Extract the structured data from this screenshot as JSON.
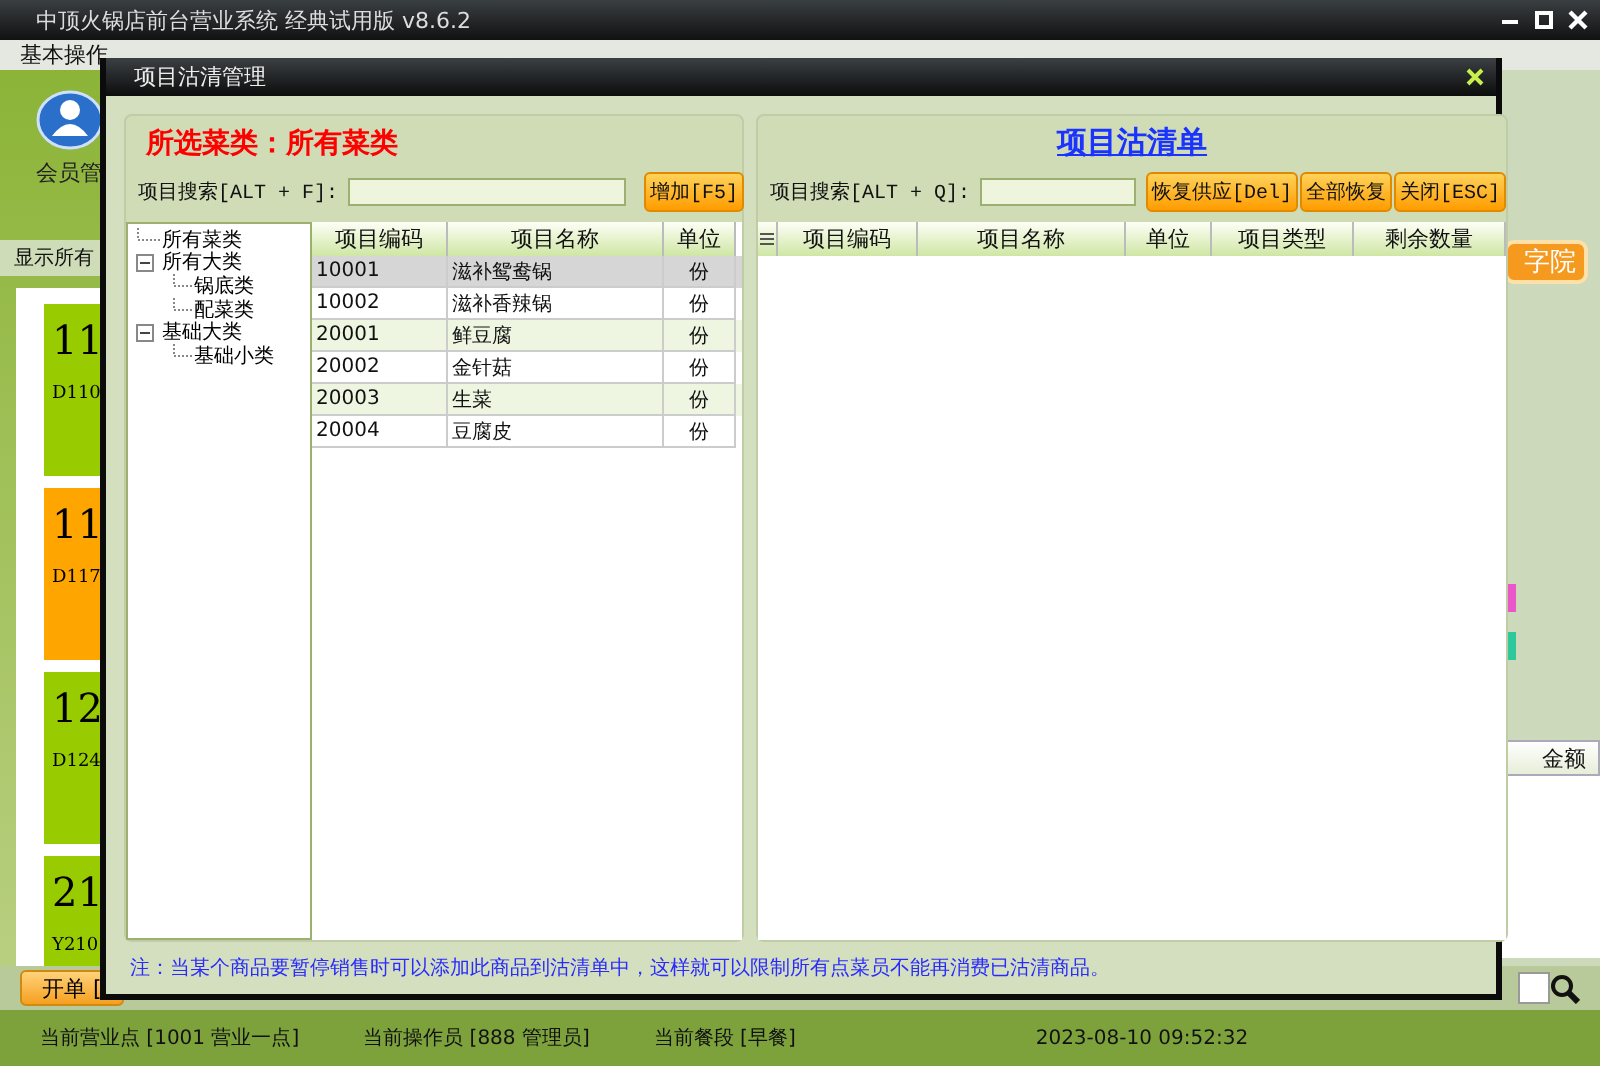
{
  "app": {
    "title": "中顶火锅店前台营业系统 经典试用版 v8.6.2",
    "menu": [
      "基本操作"
    ],
    "member_label": "会员管",
    "show_all": "显示所有",
    "tables": [
      {
        "number": "11",
        "code": "D110",
        "color": "#99cc00"
      },
      {
        "number": "11",
        "code": "D117",
        "color": "#ffa500"
      },
      {
        "number": "12",
        "code": "D124",
        "color": "#99cc00"
      },
      {
        "number": "21",
        "code": "Y210",
        "color": "#99cc00"
      }
    ],
    "academy_button": "字院",
    "swatches": [
      {
        "color": "#e957c8"
      },
      {
        "color": "#2ec99a"
      }
    ],
    "order_column": "金额",
    "open_button": "开单 ["
  },
  "dialog": {
    "title": "项目沽清管理",
    "left": {
      "heading": "所选菜类：所有菜类",
      "search_label": "项目搜索[ALT + F]:",
      "add_button": "增加[F5]",
      "tree": [
        {
          "label": "所有菜类"
        },
        {
          "label": "所有大类",
          "expanded": true,
          "children": [
            {
              "label": "锅底类"
            },
            {
              "label": "配菜类"
            }
          ]
        },
        {
          "label": "基础大类",
          "expanded": true,
          "children": [
            {
              "label": "基础小类"
            }
          ]
        }
      ],
      "columns": [
        "项目编码",
        "项目名称",
        "单位"
      ],
      "rows": [
        {
          "cells": [
            "10001",
            "滋补鸳鸯锅",
            "份"
          ],
          "selected": true
        },
        {
          "cells": [
            "10002",
            "滋补香辣锅",
            "份"
          ],
          "selected": false
        },
        {
          "cells": [
            "20001",
            "鲜豆腐",
            "份"
          ],
          "selected": false
        },
        {
          "cells": [
            "20002",
            "金针菇",
            "份"
          ],
          "selected": false
        },
        {
          "cells": [
            "20003",
            "生菜",
            "份"
          ],
          "selected": false
        },
        {
          "cells": [
            "20004",
            "豆腐皮",
            "份"
          ],
          "selected": false
        }
      ]
    },
    "right": {
      "title": "项目沽清单",
      "search_label": "项目搜索[ALT + Q]:",
      "buttons": [
        "恢复供应[Del]",
        "全部恢复",
        "关闭[ESC]"
      ],
      "columns": [
        "项目编码",
        "项目名称",
        "单位",
        "项目类型",
        "剩余数量"
      ]
    },
    "note": "注：当某个商品要暂停销售时可以添加此商品到沽清单中，这样就可以限制所有点菜员不能再消费已沽清商品。"
  },
  "status_bar": [
    "当前营业点 [1001 营业一点]",
    "当前操作员 [888 管理员]",
    "当前餐段 [早餐]",
    "2023-08-10 09:52:32"
  ]
}
